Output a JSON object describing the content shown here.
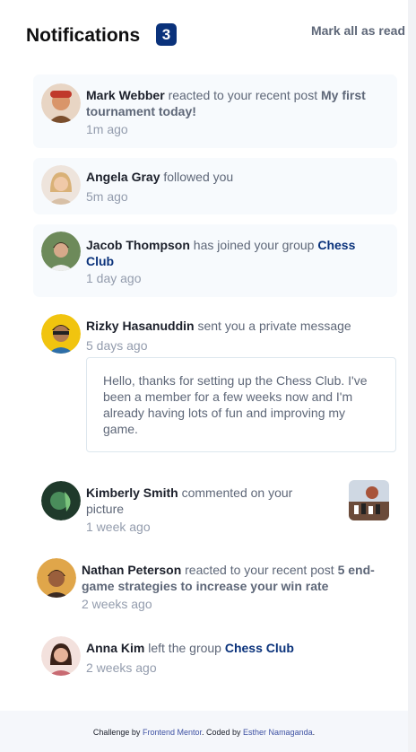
{
  "header": {
    "title": "Notifications",
    "count": "3",
    "mark_all": "Mark all as read"
  },
  "notifications": [
    {
      "name": "Mark Webber",
      "action": "reacted to your recent post",
      "post": "My first tournament today!",
      "time": "1m ago",
      "unread": true
    },
    {
      "name": "Angela Gray",
      "action": "followed you",
      "time": "5m ago",
      "unread": true
    },
    {
      "name": "Jacob Thompson",
      "action": "has joined your group",
      "group": "Chess Club",
      "time": "1 day ago",
      "unread": true
    },
    {
      "name": "Rizky Hasanuddin",
      "action": "sent you a private message",
      "time": "5 days ago",
      "message": "Hello, thanks for setting up the Chess Club. I've been a member for a few weeks now and I'm already having lots of fun and improving my game."
    },
    {
      "name": "Kimberly Smith",
      "action": "commented on your picture",
      "time": "1 week ago"
    },
    {
      "name": "Nathan Peterson",
      "action": "reacted to your recent post",
      "post": "5 end-game strategies to increase your win rate",
      "time": "2 weeks ago"
    },
    {
      "name": "Anna Kim",
      "action": "left the group",
      "group": "Chess Club",
      "time": "2 weeks ago"
    }
  ],
  "footer": {
    "prefix": "Challenge by",
    "mentor": "Frontend Mentor",
    "mid": ". Coded by",
    "author": "Esther Namaganda",
    "suffix": "."
  },
  "colors": {
    "accent": "#0a327b",
    "unread_bg": "#f7fafd",
    "muted": "#5e6778",
    "time": "#939cad"
  }
}
